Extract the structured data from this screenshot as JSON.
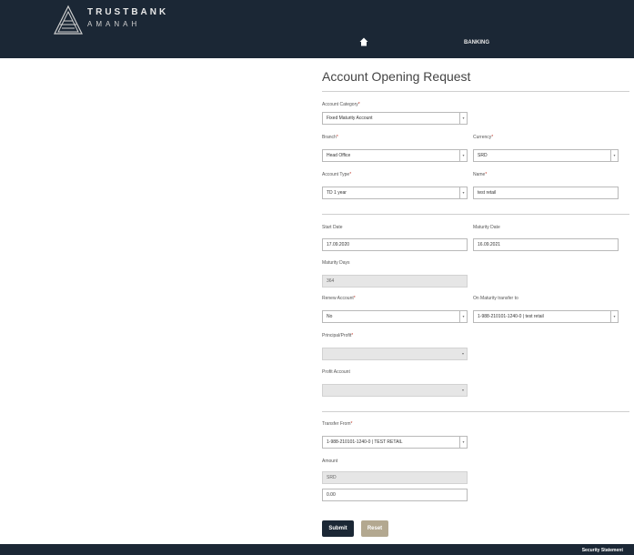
{
  "header": {
    "brand_line1": "TRUSTBANK",
    "brand_line2": "AMANAH",
    "nav_banking": "BANKING",
    "home_icon": "home-icon"
  },
  "page_title": "Account Opening Request",
  "form": {
    "account_category": {
      "label": "Account Category",
      "value": "Fixed Maturity Account"
    },
    "branch": {
      "label": "Branch",
      "value": "Head Office"
    },
    "currency": {
      "label": "Currency",
      "value": "SRD"
    },
    "account_type": {
      "label": "Account Type",
      "value": "TD 1 year"
    },
    "name": {
      "label": "Name",
      "value": "test retail"
    },
    "start_date": {
      "label": "Start Date",
      "value": "17.09.2020"
    },
    "maturity_date": {
      "label": "Maturity Date",
      "value": "16.09.2021"
    },
    "maturity_days": {
      "label": "Maturity Days",
      "value": "364"
    },
    "renew_account": {
      "label": "Renew Account",
      "value": "No"
    },
    "on_maturity_transfer": {
      "label": "On Maturity transfer to",
      "value": "1-988-210101-1240-0 | test retail"
    },
    "principal_profit": {
      "label": "Principal/Profit",
      "value": ""
    },
    "profit_account": {
      "label": "Profit Account",
      "value": ""
    },
    "transfer_from": {
      "label": "Transfer From",
      "value": "1-988-210101-1240-0 | TEST RETAIL"
    },
    "amount": {
      "label": "Amount",
      "currency": "SRD",
      "value": "0.00"
    },
    "required_mark": "*"
  },
  "buttons": {
    "submit": "Submit",
    "reset": "Reset"
  },
  "footer": {
    "security_statement": "Security Statement"
  },
  "colors": {
    "navbar": "#1b2735",
    "reset_button": "#b3a890",
    "required": "#c0392b"
  }
}
